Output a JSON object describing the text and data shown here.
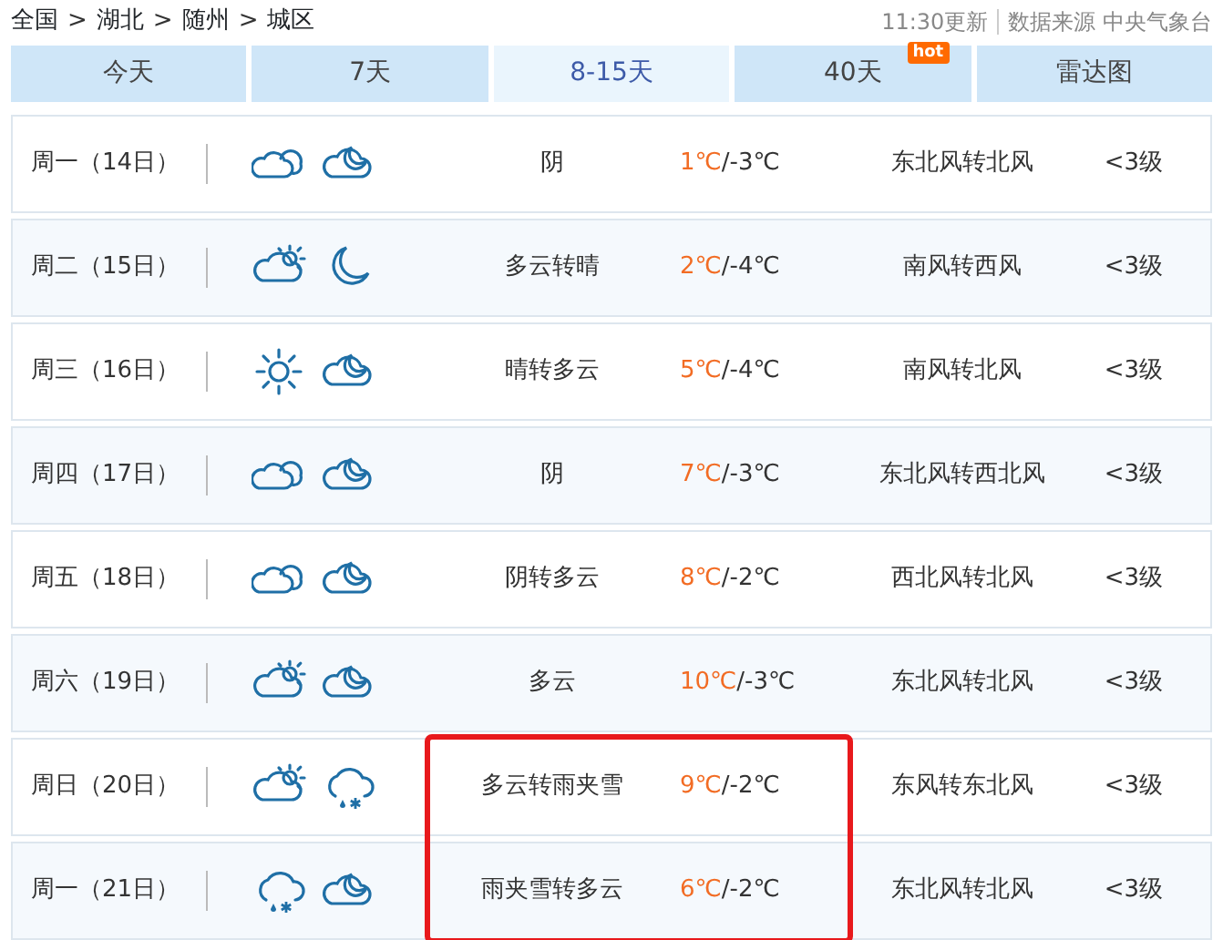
{
  "breadcrumb": [
    "全国",
    "湖北",
    "随州",
    "城区"
  ],
  "breadcrumb_separator": ">",
  "update_time": "11:30更新",
  "source": "数据来源 中央气象台",
  "tabs": [
    {
      "label": "今天",
      "selected": false
    },
    {
      "label": "7天",
      "selected": false
    },
    {
      "label": "8-15天",
      "selected": true
    },
    {
      "label": "40天",
      "selected": false,
      "badge": "hot"
    },
    {
      "label": "雷达图",
      "selected": false
    }
  ],
  "days": [
    {
      "date": "周一（14日）",
      "icons": [
        {
          "kind": "cloudy"
        },
        {
          "kind": "cloud-moon"
        }
      ],
      "weather": "阴",
      "high": "1℃",
      "low": "/-3℃",
      "wind": "东北风转北风",
      "level": "<3级",
      "highlighted": false
    },
    {
      "date": "周二（15日）",
      "icons": [
        {
          "kind": "cloud-sun"
        },
        {
          "kind": "moon"
        }
      ],
      "weather": "多云转晴",
      "high": "2℃",
      "low": "/-4℃",
      "wind": "南风转西风",
      "level": "<3级",
      "highlighted": false
    },
    {
      "date": "周三（16日）",
      "icons": [
        {
          "kind": "sun"
        },
        {
          "kind": "cloud-moon"
        }
      ],
      "weather": "晴转多云",
      "high": "5℃",
      "low": "/-4℃",
      "wind": "南风转北风",
      "level": "<3级",
      "highlighted": false
    },
    {
      "date": "周四（17日）",
      "icons": [
        {
          "kind": "cloudy"
        },
        {
          "kind": "cloud-moon"
        }
      ],
      "weather": "阴",
      "high": "7℃",
      "low": "/-3℃",
      "wind": "东北风转西北风",
      "level": "<3级",
      "highlighted": false
    },
    {
      "date": "周五（18日）",
      "icons": [
        {
          "kind": "cloudy"
        },
        {
          "kind": "cloud-moon"
        }
      ],
      "weather": "阴转多云",
      "high": "8℃",
      "low": "/-2℃",
      "wind": "西北风转北风",
      "level": "<3级",
      "highlighted": false
    },
    {
      "date": "周六（19日）",
      "icons": [
        {
          "kind": "cloud-sun"
        },
        {
          "kind": "cloud-moon"
        }
      ],
      "weather": "多云",
      "high": "10℃",
      "low": "/-3℃",
      "wind": "东北风转北风",
      "level": "<3级",
      "highlighted": false
    },
    {
      "date": "周日（20日）",
      "icons": [
        {
          "kind": "cloud-sun"
        },
        {
          "kind": "sleet"
        }
      ],
      "weather": "多云转雨夹雪",
      "high": "9℃",
      "low": "/-2℃",
      "wind": "东风转东北风",
      "level": "<3级",
      "highlighted": true
    },
    {
      "date": "周一（21日）",
      "icons": [
        {
          "kind": "sleet"
        },
        {
          "kind": "cloud-moon"
        }
      ],
      "weather": "雨夹雪转多云",
      "high": "6℃",
      "low": "/-2℃",
      "wind": "东北风转北风",
      "level": "<3级",
      "highlighted": true
    }
  ]
}
